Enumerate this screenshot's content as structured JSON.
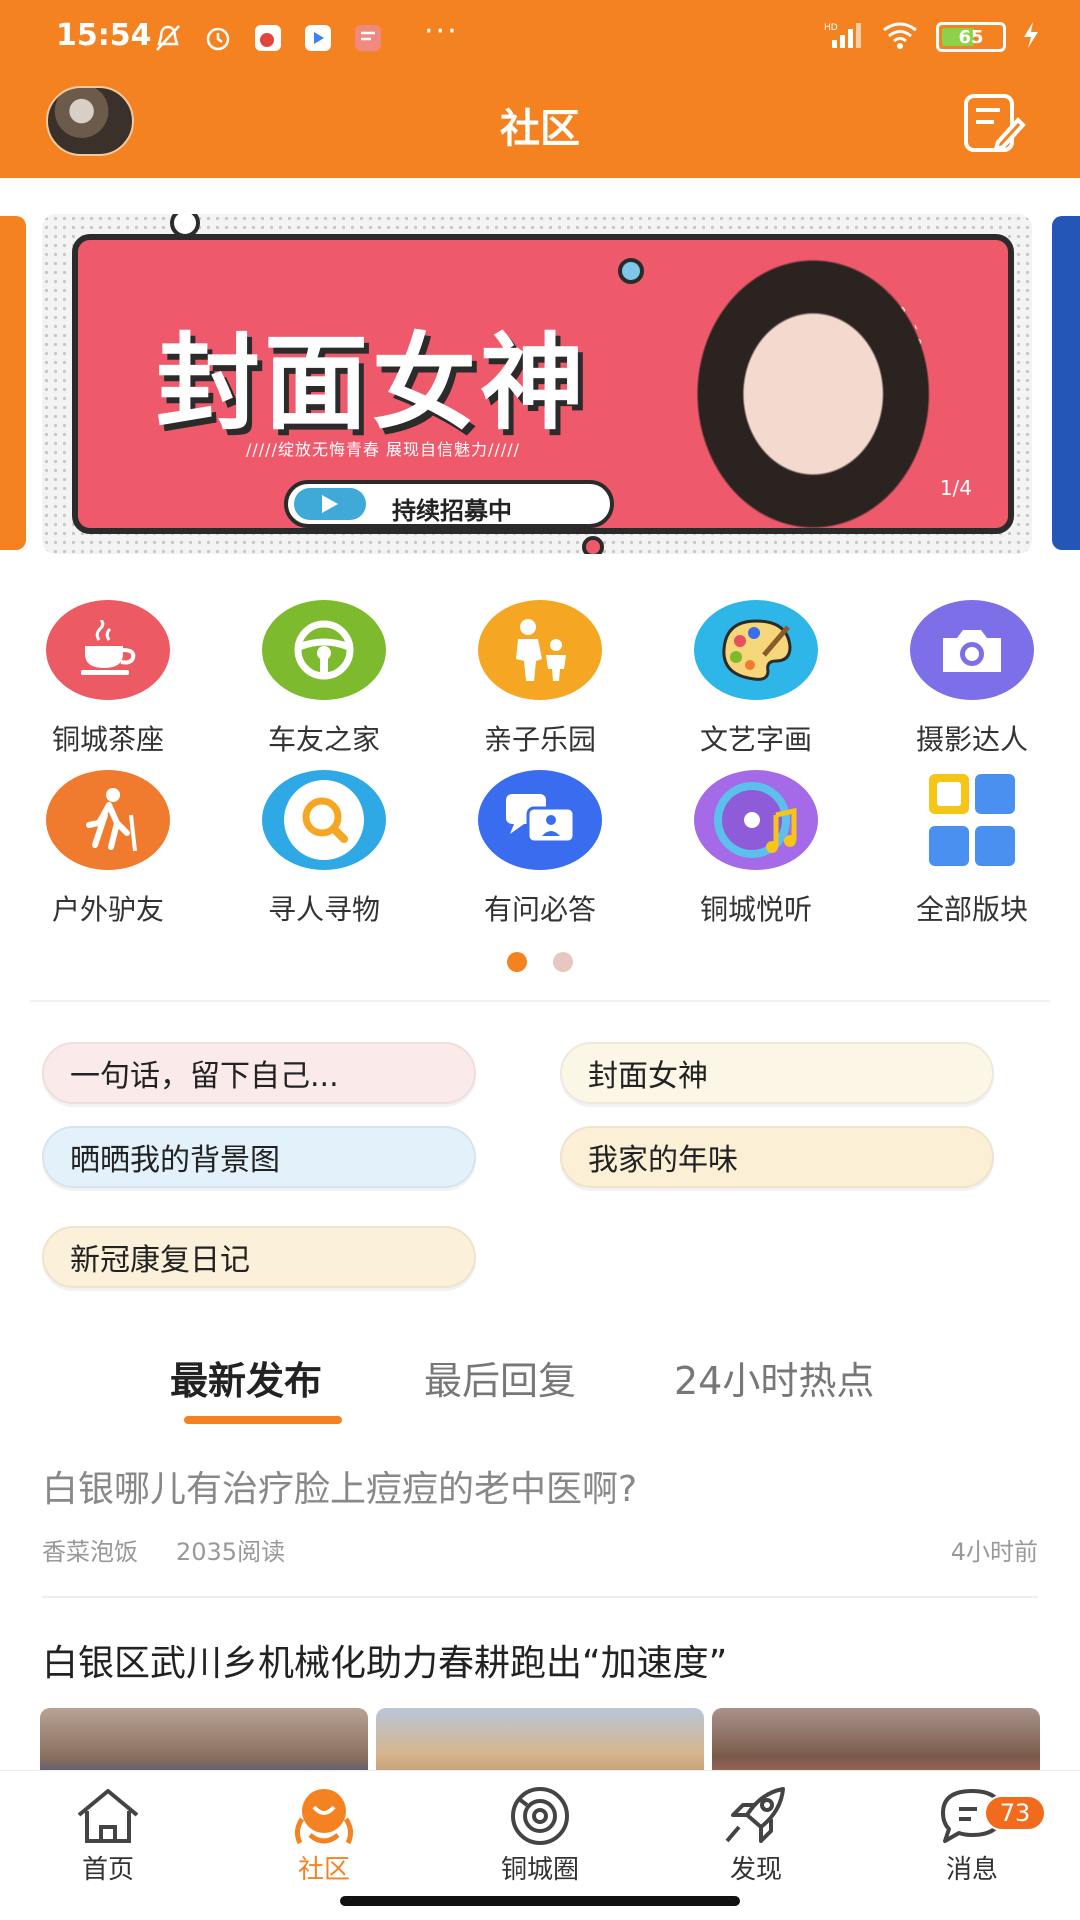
{
  "status": {
    "time": "15:54",
    "battery": "65",
    "network": "HD"
  },
  "header": {
    "title": "社区"
  },
  "banner": {
    "title": "封面女神",
    "subtitle": "/////绽放无悔青春 展现自信魅力/////",
    "cta": "持续招募中",
    "pager": "1/4"
  },
  "forums": [
    {
      "label": "铜城茶座",
      "icon": "tea-cup-icon",
      "color": "#EC5A63"
    },
    {
      "label": "车友之家",
      "icon": "steering-wheel-icon",
      "color": "#7DBA2E"
    },
    {
      "label": "亲子乐园",
      "icon": "parent-child-icon",
      "color": "#F5A623"
    },
    {
      "label": "文艺字画",
      "icon": "palette-icon",
      "color": "#2EB6E8"
    },
    {
      "label": "摄影达人",
      "icon": "camera-icon",
      "color": "#7C6FE8"
    },
    {
      "label": "户外驴友",
      "icon": "hiker-icon",
      "color": "#F07B2E"
    },
    {
      "label": "寻人寻物",
      "icon": "magnifier-icon",
      "color": "#2FA8E6"
    },
    {
      "label": "有问必答",
      "icon": "chat-icon",
      "color": "#3A6CF0"
    },
    {
      "label": "铜城悦听",
      "icon": "music-disc-icon",
      "color": "#A56AE8"
    },
    {
      "label": "全部版块",
      "icon": "all-sections-icon",
      "color": "#4A90F0"
    }
  ],
  "topics": [
    {
      "label": "一句话，留下自己...",
      "color": "#FBEAEA"
    },
    {
      "label": "封面女神",
      "color": "#FBF6E6"
    },
    {
      "label": "晒晒我的背景图",
      "color": "#E3F1FB"
    },
    {
      "label": "我家的年味",
      "color": "#FBF0D6"
    },
    {
      "label": "新冠康复日记",
      "color": "#FBF1DA"
    }
  ],
  "tabs": [
    {
      "label": "最新发布"
    },
    {
      "label": "最后回复"
    },
    {
      "label": "24小时热点"
    }
  ],
  "posts": [
    {
      "title": "白银哪儿有治疗脸上痘痘的老中医啊?",
      "author": "香菜泡饭",
      "reads": "2035阅读",
      "time": "4小时前"
    },
    {
      "title": "白银区武川乡机械化助力春耕跑出“加速度”"
    }
  ],
  "nav": [
    {
      "label": "首页",
      "icon": "home-icon"
    },
    {
      "label": "社区",
      "icon": "community-icon"
    },
    {
      "label": "铜城圈",
      "icon": "circle-icon"
    },
    {
      "label": "发现",
      "icon": "rocket-icon"
    },
    {
      "label": "消息",
      "icon": "message-icon",
      "badge": "73"
    }
  ],
  "colors": {
    "brand": "#F58220",
    "background": "#FFFFFF"
  }
}
